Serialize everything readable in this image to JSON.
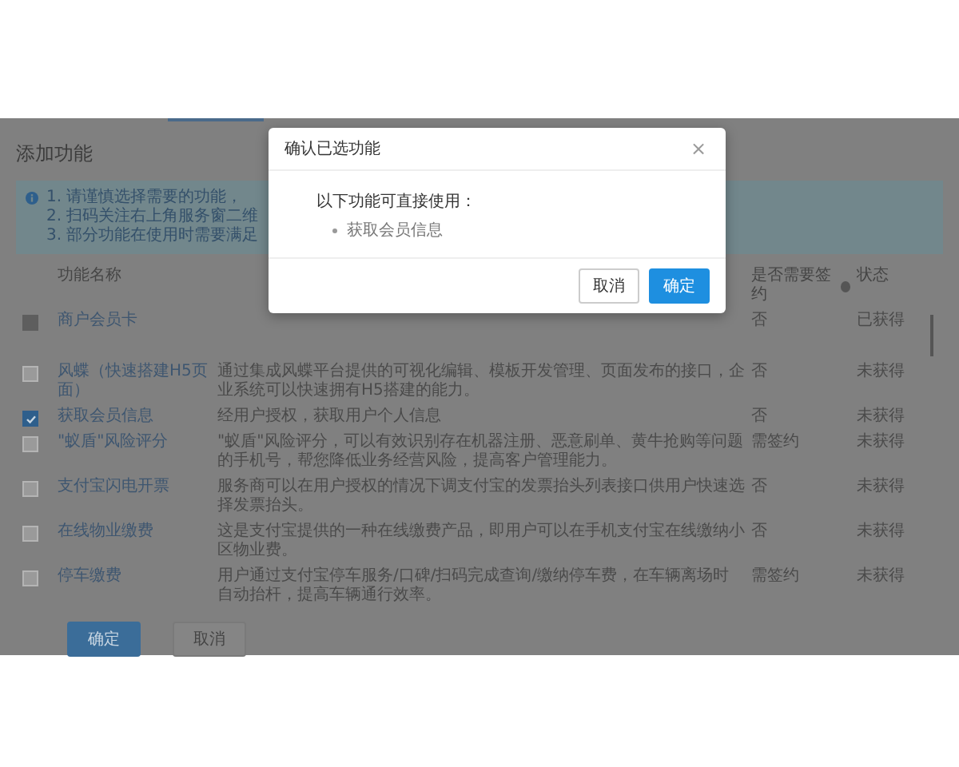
{
  "page": {
    "title": "添加功能"
  },
  "tips": [
    "1. 请谨慎选择需要的功能，",
    "2. 扫码关注右上角服务窗二维",
    "3. 部分功能在使用时需要满足"
  ],
  "table": {
    "columns": [
      "功能名称",
      "是否需要签约",
      "状态"
    ],
    "rows": [
      {
        "name": "商户会员卡",
        "description": "",
        "signing": "否",
        "status": "已获得",
        "checked": false,
        "disabled": true
      },
      {
        "name": "风蝶（快速搭建H5页面）",
        "description": "通过集成风蝶平台提供的可视化编辑、模板开发管理、页面发布的接口，企业系统可以快速拥有H5搭建的能力。",
        "signing": "否",
        "status": "未获得",
        "checked": false,
        "disabled": false
      },
      {
        "name": "获取会员信息",
        "description": "经用户授权，获取用户个人信息",
        "signing": "否",
        "status": "未获得",
        "checked": true,
        "disabled": false
      },
      {
        "name": "\"蚁盾\"风险评分",
        "description": "\"蚁盾\"风险评分，可以有效识别存在机器注册、恶意刷单、黄牛抢购等问题的手机号，帮您降低业务经营风险，提高客户管理能力。",
        "signing": "需签约",
        "status": "未获得",
        "checked": false,
        "disabled": false
      },
      {
        "name": "支付宝闪电开票",
        "description": "服务商可以在用户授权的情况下调支付宝的发票抬头列表接口供用户快速选择发票抬头。",
        "signing": "否",
        "status": "未获得",
        "checked": false,
        "disabled": false
      },
      {
        "name": "在线物业缴费",
        "description": "这是支付宝提供的一种在线缴费产品，即用户可以在手机支付宝在线缴纳小区物业费。",
        "signing": "否",
        "status": "未获得",
        "checked": false,
        "disabled": false
      },
      {
        "name": "停车缴费",
        "description": "用户通过支付宝停车服务/口碑/扫码完成查询/缴纳停车费，在车辆离场时自动抬杆，提高车辆通行效率。",
        "signing": "需签约",
        "status": "未获得",
        "checked": false,
        "disabled": false
      }
    ]
  },
  "buttons": [
    {
      "label": "确定",
      "kind": "primary"
    },
    {
      "label": "取消",
      "kind": "default"
    }
  ],
  "dialog": {
    "title": "确认已选功能",
    "close": "×",
    "message": "以下功能可直接使用：",
    "items": [
      "获取会员信息"
    ],
    "buttons": [
      {
        "label": "取消",
        "kind": "default"
      },
      {
        "label": "确定",
        "kind": "primary"
      }
    ]
  }
}
